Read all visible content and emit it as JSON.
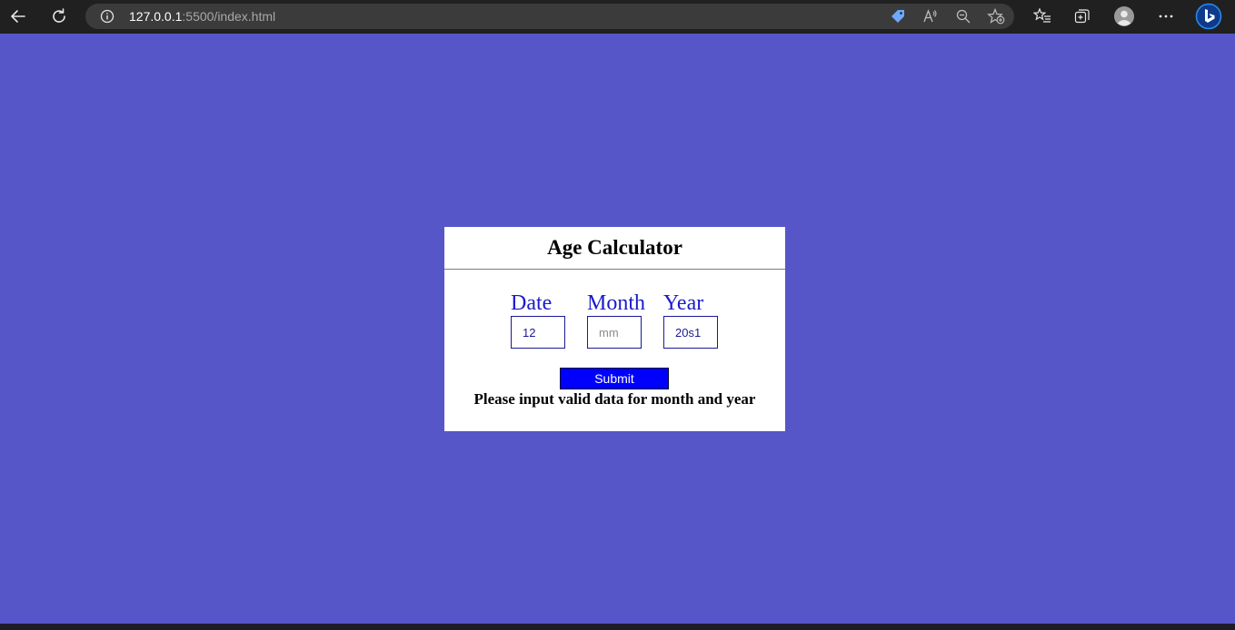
{
  "browser": {
    "url_host": "127.0.0.1",
    "url_rest": ":5500/index.html",
    "icons": [
      "back-arrow-icon",
      "refresh-icon",
      "site-info-icon",
      "tag-icon",
      "read-aloud-icon",
      "zoom-out-icon",
      "add-favorite-icon",
      "favorites-icon",
      "collections-icon",
      "profile-avatar-icon",
      "more-menu-icon",
      "bing-copilot-icon"
    ]
  },
  "page": {
    "background": "#5656c9"
  },
  "calculator": {
    "title": "Age Calculator",
    "fields": {
      "date_label": "Date",
      "date_value": "12",
      "month_label": "Month",
      "month_value": "",
      "month_placeholder": "mm",
      "year_label": "Year",
      "year_value": "20s1"
    },
    "submit_label": "Submit",
    "submit_color": "#0000ff",
    "message": "Please input valid data for month and year"
  }
}
